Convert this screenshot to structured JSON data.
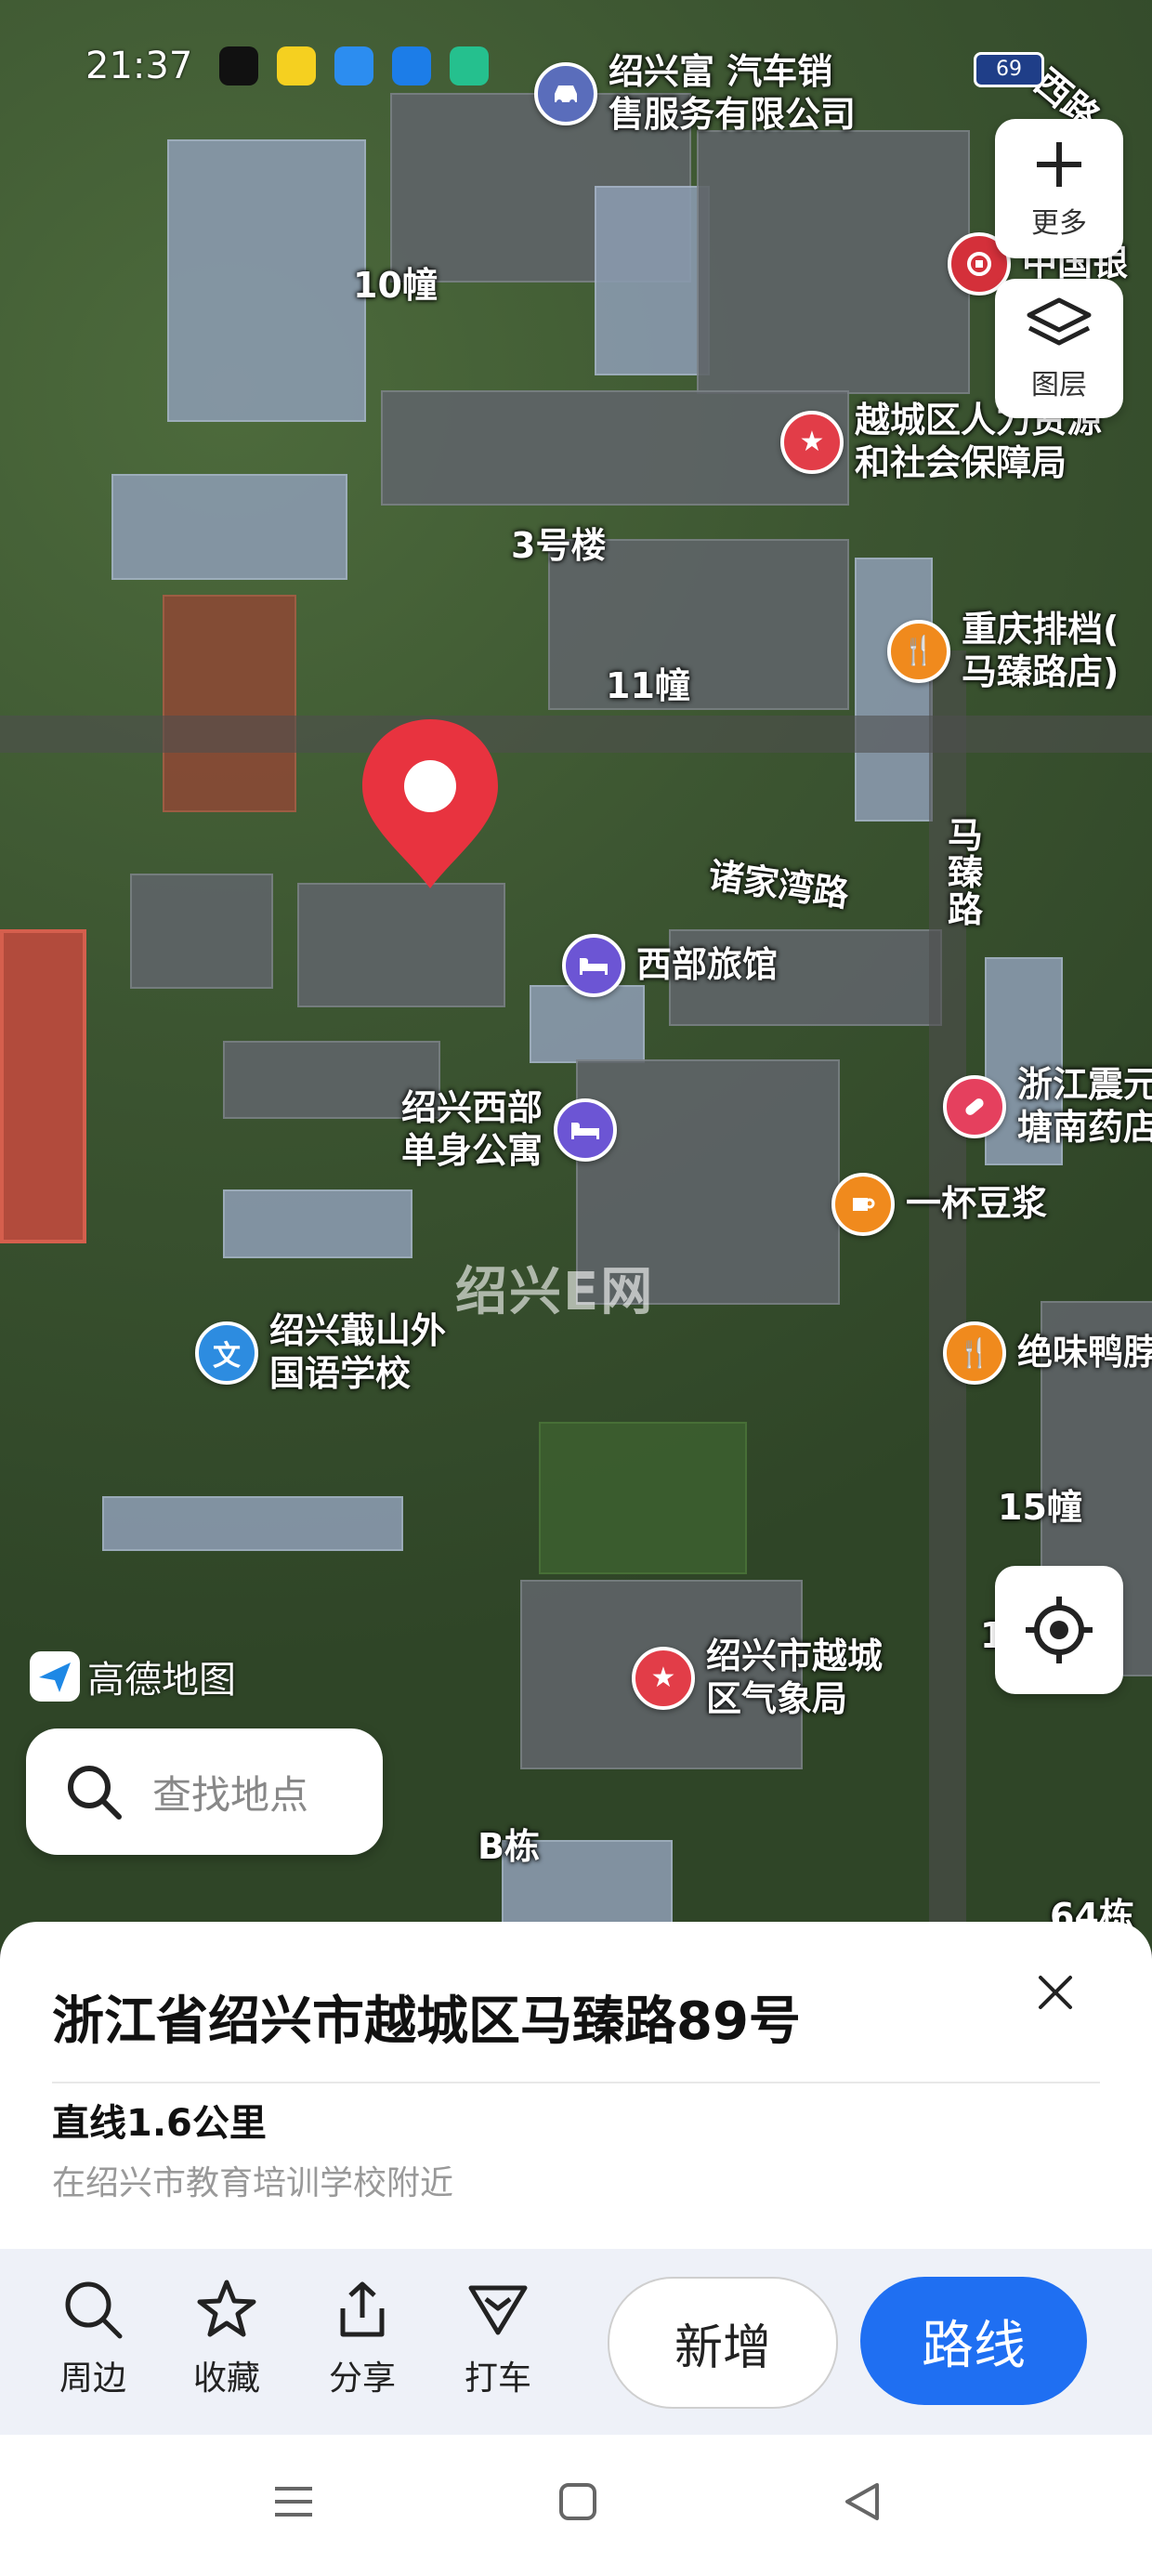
{
  "status_bar": {
    "time": "21:37",
    "battery": "69"
  },
  "top_poi": {
    "line1": "绍兴富 汽车销",
    "line2": "售服务有限公司"
  },
  "buttons": {
    "more": "更多",
    "layers": "图层"
  },
  "map_labels": {
    "bldg10": "10幢",
    "bldg3": "3号楼",
    "bldg11": "11幢",
    "bldg15": "15幢",
    "bldgB": "B栋",
    "bldg64": "64栋",
    "road_zhujiawan": "诸家湾路",
    "road_mazhen": "马\n臻\n路",
    "road_xixi": "西路",
    "bank": "中国银",
    "num1": "1"
  },
  "pois": {
    "hr_bureau": [
      "越城区人力资源",
      "和社会保障局"
    ],
    "chongqing": [
      "重庆排档(",
      "马臻路店)"
    ],
    "xibu_hotel": "西部旅馆",
    "apartment": [
      "绍兴西部",
      "单身公寓"
    ],
    "pharmacy": [
      "浙江震元",
      "塘南药店"
    ],
    "soymilk": "一杯豆浆",
    "duck": "绝味鸭脖",
    "school": [
      "绍兴蕺山外",
      "国语学校"
    ],
    "weather": [
      "绍兴市越城",
      "区气象局"
    ]
  },
  "watermark": "绍兴E网",
  "brand": "高德地图",
  "search": {
    "placeholder": "查找地点"
  },
  "sheet": {
    "address": "浙江省绍兴市越城区马臻路89号",
    "distance": "直线1.6公里",
    "nearby": "在绍兴市教育培训学校附近"
  },
  "actions": {
    "nearby": "周边",
    "favorite": "收藏",
    "share": "分享",
    "taxi": "打车",
    "add": "新增",
    "route": "路线"
  },
  "colors": {
    "route_blue": "#1f6ff2",
    "marker_red": "#e8333f"
  }
}
